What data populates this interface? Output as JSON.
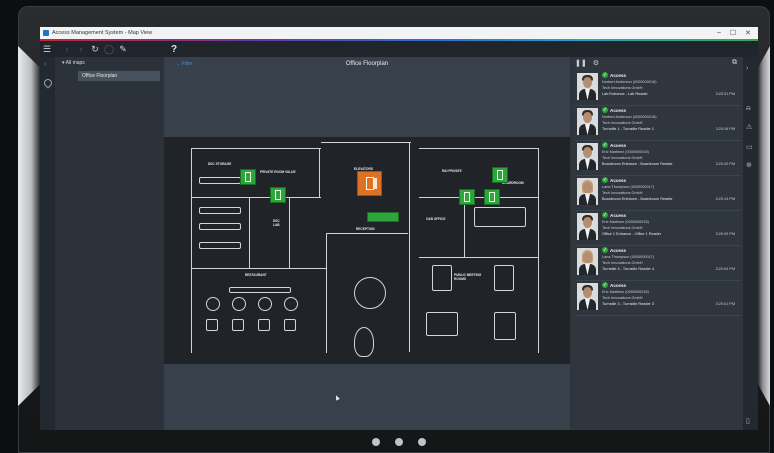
{
  "window": {
    "title": "Access Management System - Map View",
    "controls": [
      "–",
      "☐",
      "✕"
    ]
  },
  "toolbar": {
    "help": "?"
  },
  "tree": {
    "root": "All maps",
    "selected": "Office Floorplan"
  },
  "map": {
    "filter": "Filter",
    "title": "Office Floorplan",
    "rooms": {
      "dsc_storage": "DSC STORAGE",
      "private_room": "PRIVATE ROOM VALUE",
      "elevators": "ELEVATORS",
      "rd_private": "R&I PRIVATE",
      "boardroom": "BOARDROOM",
      "cab_office": "C&B OFFICE",
      "dsc_lab": "DSC LAB",
      "reception": "RECEPTION",
      "restaurant": "RESTAURANT",
      "meeting_rooms": "PUBLIC MEETING ROOMS"
    }
  },
  "events": [
    {
      "status": "Access",
      "person": "Norbert Anderson (0000000016)",
      "company": "Tech Innovations GmbH",
      "reader": "Lab Entrance - Lab Reader",
      "time": "3:20:31 PM",
      "gender": "m"
    },
    {
      "status": "Access",
      "person": "Norbert Anderson (0000000016)",
      "company": "Tech Innovations GmbH",
      "reader": "Turnstile 1 - Turnstile Reader 1",
      "time": "3:20:26 PM",
      "gender": "m"
    },
    {
      "status": "Access",
      "person": "Eric Martinez (0000000015)",
      "company": "Tech Innovations GmbH",
      "reader": "Boardroom Entrance - Boardroom Reader",
      "time": "3:20:20 PM",
      "gender": "m"
    },
    {
      "status": "Access",
      "person": "Lana Thompson (0000000017)",
      "company": "Tech Innovations GmbH",
      "reader": "Boardroom Entrance - Boardroom Reader",
      "time": "3:20:13 PM",
      "gender": "f"
    },
    {
      "status": "Access",
      "person": "Eric Martinez (0000000015)",
      "company": "Tech Innovations GmbH",
      "reader": "Office 1 Entrance - Office 1 Reader",
      "time": "3:20:09 PM",
      "gender": "m"
    },
    {
      "status": "Access",
      "person": "Lana Thompson (0000000017)",
      "company": "Tech Innovations GmbH",
      "reader": "Turnstile 4 - Turnstile Reader 4",
      "time": "3:20:04 PM",
      "gender": "f"
    },
    {
      "status": "Access",
      "person": "Eric Martinez (0000000015)",
      "company": "Tech Innovations GmbH",
      "reader": "Turnstile 3 - Turnstile Reader 3",
      "time": "3:20:01 PM",
      "gender": "m"
    }
  ],
  "colors": {
    "access_green": "#2fa53d",
    "alarm_orange": "#e07024",
    "link_blue": "#3d8ed8"
  }
}
